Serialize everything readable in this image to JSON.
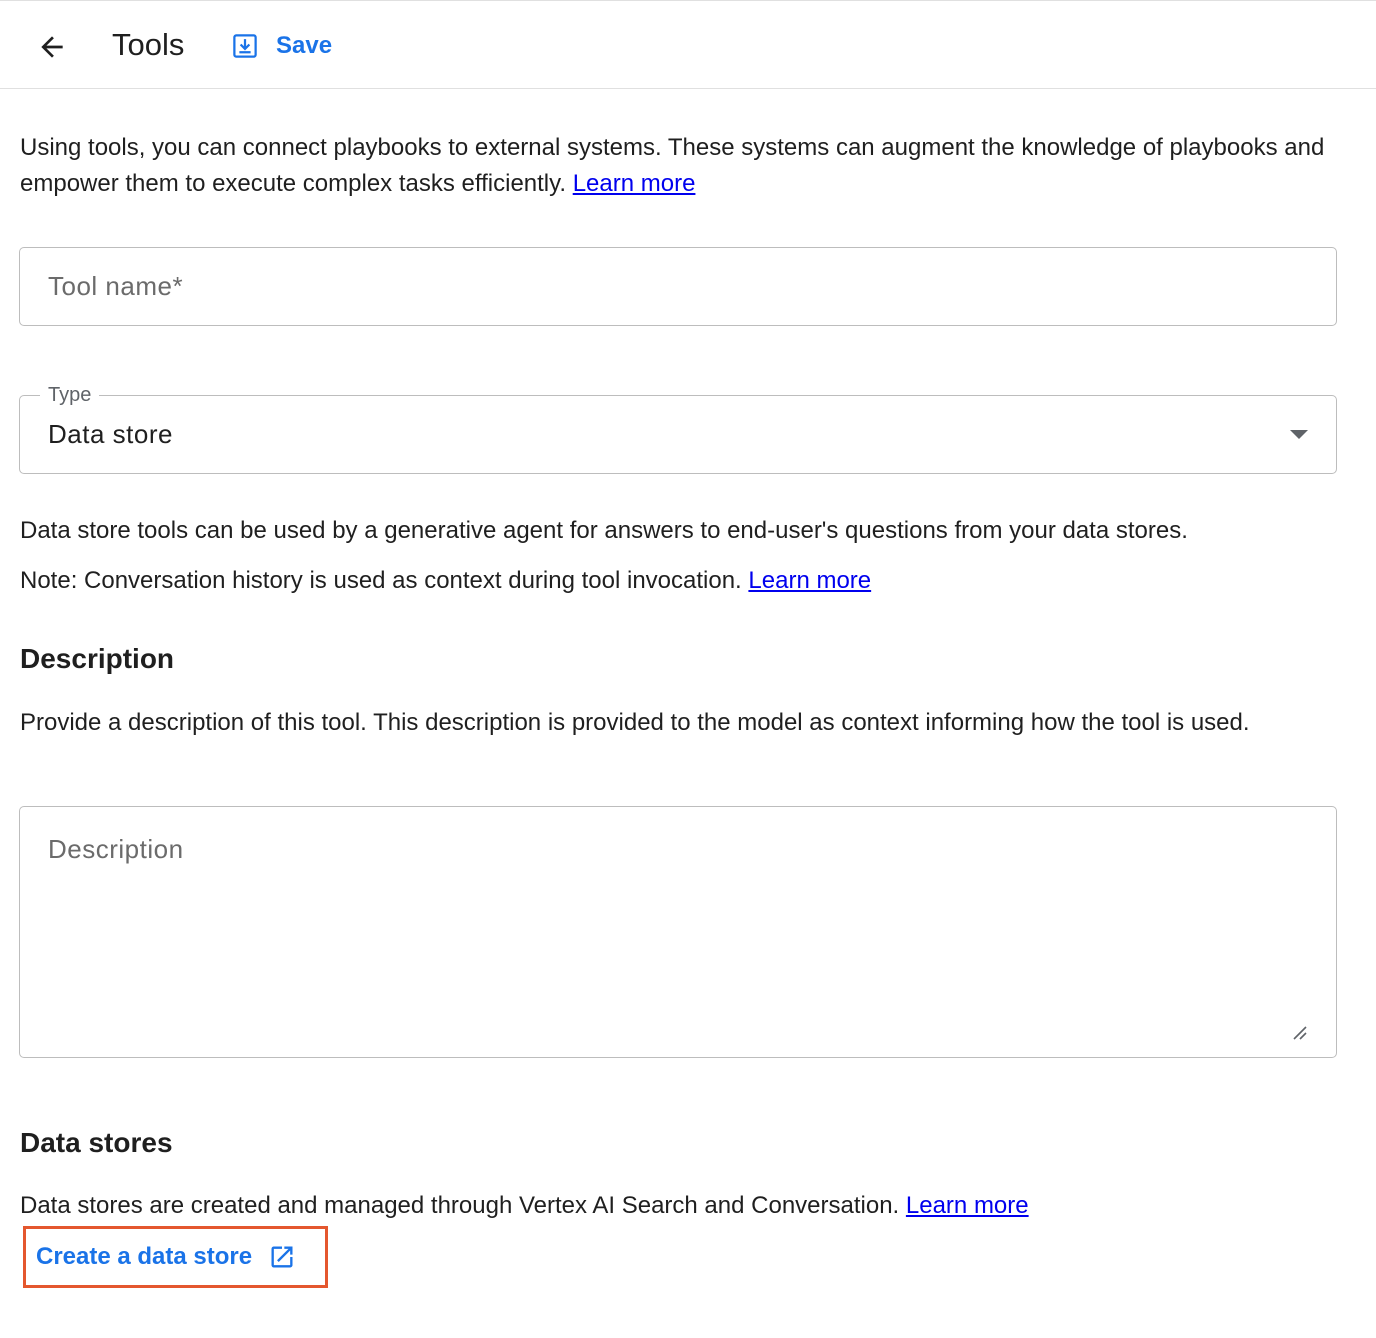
{
  "header": {
    "title": "Tools",
    "save_label": "Save"
  },
  "intro": {
    "text": "Using tools, you can connect playbooks to external systems. These systems can augment the knowledge of playbooks and empower them to execute complex tasks efficiently.",
    "learn_more": "Learn more"
  },
  "tool_name": {
    "placeholder": "Tool name*",
    "value": ""
  },
  "type": {
    "label": "Type",
    "value": "Data store"
  },
  "type_info": {
    "line1": "Data store tools can be used by a generative agent for answers to end-user's questions from your data stores.",
    "line2": "Note: Conversation history is used as context during tool invocation.",
    "learn_more": "Learn more"
  },
  "description": {
    "heading": "Description",
    "help": "Provide a description of this tool. This description is provided to the model as context informing how the tool is used.",
    "placeholder": "Description",
    "value": ""
  },
  "data_stores": {
    "heading": "Data stores",
    "help": "Data stores are created and managed through Vertex AI Search and Conversation.",
    "learn_more": "Learn more",
    "create_label": "Create a data store"
  },
  "icons": {
    "back": "arrow-back-icon",
    "save": "save-icon",
    "dropdown": "arrow-drop-down-icon",
    "external": "open-in-new-icon",
    "resize": "resize-handle-icon"
  },
  "colors": {
    "accent": "#1a73e8",
    "link": "#0000ee",
    "highlight_border": "#e4572e"
  }
}
